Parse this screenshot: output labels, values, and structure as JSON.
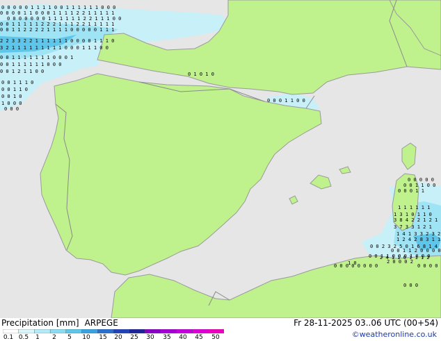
{
  "map": {
    "region": "Iberian Peninsula and western Mediterranean",
    "colors": {
      "sea": "#e6e6e6",
      "land": "#bff28c",
      "coast": "#9a9a9a",
      "border": "#8a8a8a",
      "precip_light": "#c8f0f8",
      "precip_mid": "#9ee4f4",
      "precip_heavy": "#5ec6ea"
    },
    "value_rows": [
      "0 0 0 0 0 1 1 1 1 0 0 1 1 1 1 1 1 0 0 0",
      "0 0 0 0 1 1 0 0 0 1 1 1 1 2 2 1 1 1 1 1",
      "0 0 0 0 0 0 0 1 1 1 1 1 1 2 2 1 1 1 0 0",
      "0 0 1 1 1 1 1 2 2 2 1 1 1 2 2 1 1 1 1 1",
      "0 0 1 1 2 2 2 2 1 1 1 1 0 0 0 0 0 1 1 1",
      "2 2 3 3 2 2 1 1 1 1 1 1 0 0 0 0 1 1 1 0",
      "3 2 1 1 1 1 1 1 1 1 1 0 0 0 1 1 1 0 0",
      "0 0 1 1 1 1 1 1 1 0 0 0 1",
      "0 0 1 1 1 1 1 1 0 0 0",
      "0 0 1 2 1 1 0 0",
      "0 0 1 1 1 0",
      "0 0 1 1 0",
      "0 0 1 0",
      "1 0 0 0",
      "0 0 0",
      "0 1 0 1 0",
      "0 0 0 1 1 0 0",
      "0 0 1 1 2 0 0 0 0 0 1 1 0 0",
      "0 0 1 1 0 0 0 1 0 0 0",
      "0 0 0 0 0 0 0 0",
      "0 0 0 0",
      "0 0 0 0 0",
      "0 0 1 1 0 0",
      "0 0 0 1 1",
      "1 1 1 1 1 1",
      "1 3 1 0 1 1 0",
      "3 8 4 2 2 1 2 1",
      "3 7 3 3 1 2 1",
      "1 4 1 3 3 2 3 2",
      "1 2 4 2 8 3 1 1 7 8",
      "0 0 2 3 2 5 0 1 6 8 1 4",
      "2 4 1 1 0 1 1 1 2",
      "2 0 0 0 2",
      "1 0",
      "0 0 0"
    ]
  },
  "legend": {
    "title": "Precipitation [mm]",
    "model": "ARPEGE",
    "scale_labels": [
      "0.1",
      "0.5",
      "1",
      "2",
      "5",
      "10",
      "15",
      "20",
      "25",
      "30",
      "35",
      "40",
      "45",
      "50"
    ],
    "scale_colors": [
      "#ffffff",
      "#d8f5fb",
      "#b4ebf8",
      "#8adcf2",
      "#5ec6ea",
      "#3aa2e0",
      "#2a6fd0",
      "#2442b8",
      "#1c2498",
      "#8a00c8",
      "#a800d8",
      "#c800e0",
      "#e000d8",
      "#f000c0"
    ]
  },
  "timestamp": "Fr 28-11-2025 03..06 UTC (00+54)",
  "credit": "©weatheronline.co.uk"
}
